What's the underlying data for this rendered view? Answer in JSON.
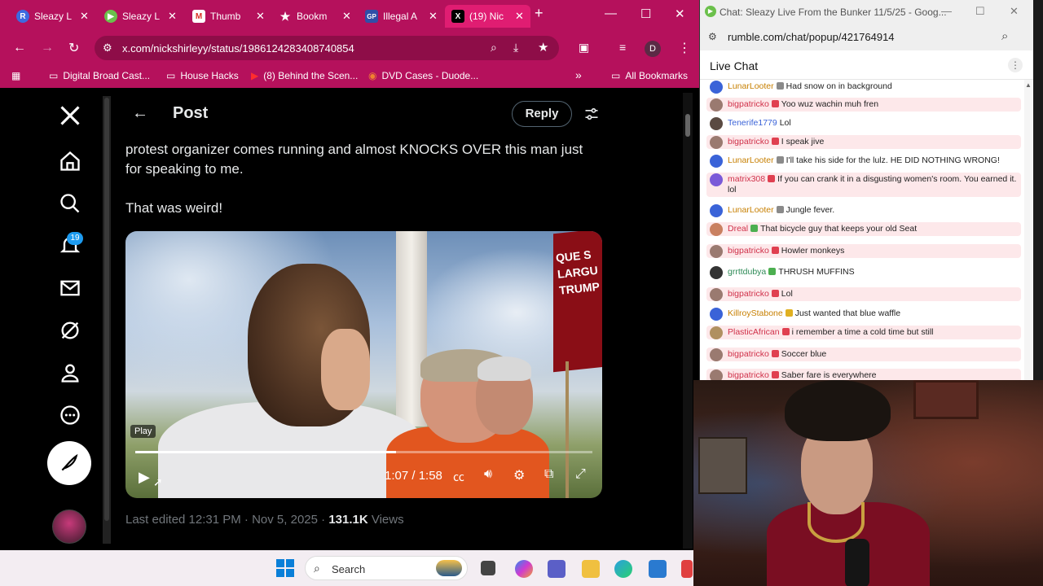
{
  "browser": {
    "tabs": [
      {
        "label": "Sleazy L",
        "favicon": "R",
        "color": "#3d6be0"
      },
      {
        "label": "Sleazy L",
        "favicon": "▶",
        "color": "#6bc04b"
      },
      {
        "label": "Thumb",
        "favicon": "M",
        "color": "#d93025"
      },
      {
        "label": "Bookm",
        "favicon": "★",
        "color": "transparent"
      },
      {
        "label": "Illegal A",
        "favicon": "GP",
        "color": "#2f4fa8"
      },
      {
        "label": "(19) Nic",
        "favicon": "X",
        "color": "#000000"
      }
    ],
    "url": "x.com/nickshirleyy/status/1986124283408740854",
    "profile_initial": "D",
    "bookmarks": [
      {
        "label": "Digital Broad Cast..."
      },
      {
        "label": "House Hacks"
      },
      {
        "label": "(8) Behind the Scen..."
      },
      {
        "label": "DVD Cases - Duode..."
      }
    ],
    "all_bookmarks": "All Bookmarks"
  },
  "x": {
    "notifications_badge": "19",
    "header_title": "Post",
    "reply_label": "Reply",
    "tweet_text": "protest organizer comes running and almost KNOCKS OVER this man just for speaking to me.",
    "tweet_text2": "That was weird!",
    "video": {
      "sign_text": "QUE S LARGU TRUMP",
      "tooltip": "Play",
      "time": "1:07 / 1:58",
      "progress": 0.57
    },
    "meta_edited": "Last edited 12:31 PM · Nov 5, 2025 · ",
    "meta_views_count": "131.1K",
    "meta_views_label": " Views"
  },
  "chat": {
    "window_title": "Chat: Sleazy Live From the Bunker 11/5/25 - Goog...",
    "url": "rumble.com/chat/popup/421764914",
    "header": "Live Chat",
    "messages": [
      {
        "user": "LunarLooter",
        "text": "Had snow on in background",
        "color": "#c77f00",
        "av": "#3a63d8",
        "hl": false,
        "badge": "#8a8a8a"
      },
      {
        "user": "bigpatricko",
        "text": "Yoo wuz wachin muh fren",
        "color": "#d0314a",
        "av": "#9a7a70",
        "hl": true,
        "badge": "#e04050"
      },
      {
        "user": "Tenerife1779",
        "text": "Lol",
        "color": "#3a63d8",
        "av": "#5a4a42",
        "hl": false,
        "badge": ""
      },
      {
        "user": "bigpatricko",
        "text": "I speak jive",
        "color": "#d0314a",
        "av": "#9a7a70",
        "hl": true,
        "badge": "#e04050"
      },
      {
        "user": "LunarLooter",
        "text": "I'll take his side for the lulz. HE DID NOTHING WRONG!",
        "color": "#c77f00",
        "av": "#3a63d8",
        "hl": false,
        "badge": "#8a8a8a"
      },
      {
        "user": "matrix308",
        "text": "If you can crank it in a disgusting women's room. You earned it. lol",
        "color": "#d0314a",
        "av": "#7a5ad8",
        "hl": true,
        "badge": "#e04050"
      },
      {
        "user": "LunarLooter",
        "text": "Jungle fever.",
        "color": "#c77f00",
        "av": "#3a63d8",
        "hl": false,
        "badge": "#8a8a8a"
      },
      {
        "user": "Dreal",
        "text": "That bicycle guy that keeps your old Seat",
        "color": "#d0314a",
        "av": "#c98060",
        "hl": true,
        "badge": "#4caf50"
      },
      {
        "user": "bigpatricko",
        "text": "Howler monkeys",
        "color": "#d0314a",
        "av": "#9a7a70",
        "hl": true,
        "badge": "#e04050"
      },
      {
        "user": "grrttdubya",
        "text": "THRUSH MUFFINS",
        "color": "#2e8b57",
        "av": "#333333",
        "hl": false,
        "badge": "#4caf50"
      },
      {
        "user": "bigpatricko",
        "text": "Lol",
        "color": "#d0314a",
        "av": "#9a7a70",
        "hl": true,
        "badge": "#e04050"
      },
      {
        "user": "KillroyStabone",
        "text": "Just wanted that blue waffle",
        "color": "#c77f00",
        "av": "#3a63d8",
        "hl": false,
        "badge": "#e0b020"
      },
      {
        "user": "PlasticAfrican",
        "text": "i remember a time a cold time but still",
        "color": "#d0314a",
        "av": "#b09060",
        "hl": true,
        "badge": "#e04050"
      },
      {
        "user": "bigpatricko",
        "text": "Soccer blue",
        "color": "#d0314a",
        "av": "#9a7a70",
        "hl": true,
        "badge": "#e04050"
      },
      {
        "user": "bigpatricko",
        "text": "Saber fare is everywhere",
        "color": "#d0314a",
        "av": "#9a7a70",
        "hl": true,
        "badge": "#e04050"
      }
    ]
  },
  "taskbar": {
    "search_placeholder": "Search"
  }
}
